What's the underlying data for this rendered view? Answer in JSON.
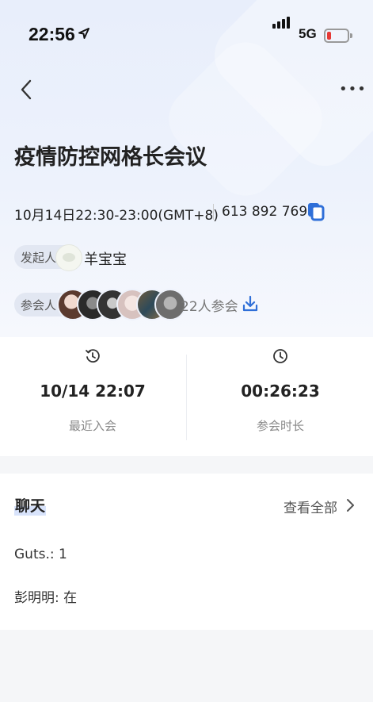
{
  "status_bar": {
    "time": "22:56",
    "network": "5G"
  },
  "meeting": {
    "title": "疫情防控网格长会议",
    "datetime": "10月14日22:30-23:00(GMT+8)",
    "meeting_id": "613 892 769",
    "host_label": "发起人",
    "host_name": "羊宝宝",
    "attendees_label": "参会人",
    "attendees_count": "22人参会"
  },
  "stats": {
    "last_join_value": "10/14 22:07",
    "last_join_label": "最近入会",
    "duration_value": "00:26:23",
    "duration_label": "参会时长"
  },
  "chat": {
    "title": "聊天",
    "view_all": "查看全部",
    "messages": [
      {
        "text": "Guts.: 1"
      },
      {
        "text": "彭明明: 在"
      }
    ]
  },
  "colors": {
    "accent": "#2f6fd8",
    "battery_low": "#e53935"
  }
}
